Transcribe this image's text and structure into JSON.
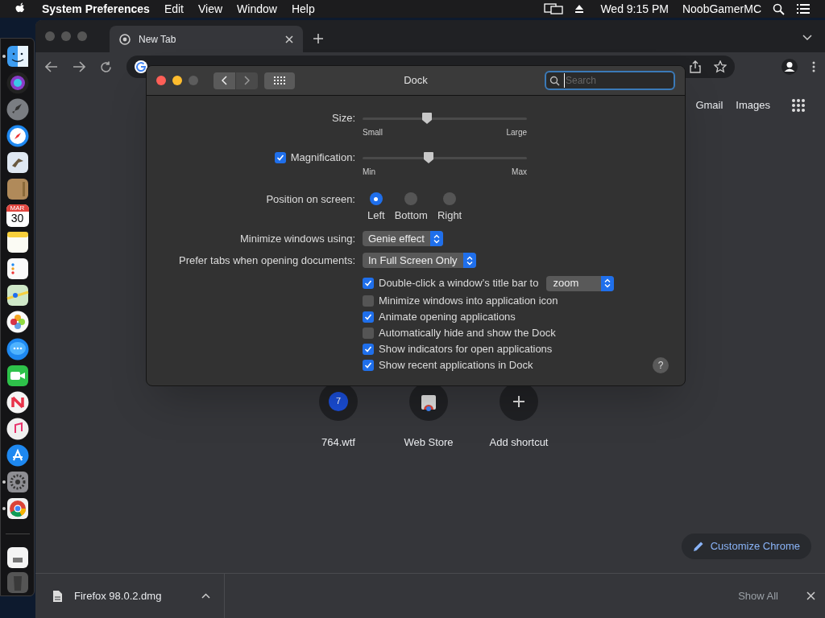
{
  "menu_bar": {
    "app": "System Preferences",
    "menus": [
      "Edit",
      "View",
      "Window",
      "Help"
    ],
    "clock": "Wed 9:15 PM",
    "user": "NoobGamerMC"
  },
  "dock": {
    "items": [
      {
        "kind": "finder",
        "running": true
      },
      {
        "kind": "siri",
        "running": false
      },
      {
        "kind": "launchpad",
        "running": false
      },
      {
        "kind": "safari",
        "running": false
      },
      {
        "kind": "mail",
        "running": false
      },
      {
        "kind": "contacts",
        "running": false
      },
      {
        "kind": "calendar",
        "running": false,
        "month": "MAR",
        "day": "30"
      },
      {
        "kind": "notes",
        "running": false
      },
      {
        "kind": "reminders",
        "running": false
      },
      {
        "kind": "maps",
        "running": false
      },
      {
        "kind": "photos",
        "running": false
      },
      {
        "kind": "messages",
        "running": false
      },
      {
        "kind": "facetime",
        "running": false
      },
      {
        "kind": "news",
        "running": false
      },
      {
        "kind": "music",
        "running": false
      },
      {
        "kind": "appstore",
        "running": false
      },
      {
        "kind": "prefs",
        "running": true
      },
      {
        "kind": "chrome",
        "running": true
      }
    ],
    "extras": [
      {
        "kind": "document"
      },
      {
        "kind": "trash"
      }
    ]
  },
  "browser": {
    "tabs": [
      {
        "title": "New Tab",
        "selected": true
      }
    ],
    "links": [
      "Gmail",
      "Images"
    ],
    "shortcuts": [
      {
        "kind": "letter",
        "letter": "7",
        "label": "764.wtf"
      },
      {
        "kind": "store",
        "label": "Web Store"
      },
      {
        "kind": "add",
        "label": "Add shortcut"
      }
    ],
    "customize": "Customize Chrome",
    "download": {
      "file": "Firefox 98.0.2.dmg",
      "show_all": "Show All"
    }
  },
  "prefs": {
    "title": "Dock",
    "search": {
      "placeholder": "Search"
    },
    "sliders": [
      {
        "kind": "plain",
        "label": "Size:",
        "level": 0.39,
        "min": "Small",
        "max": "Large"
      },
      {
        "kind": "checkable",
        "label": "Magnification:",
        "checked": true,
        "level": 0.4,
        "min": "Min",
        "max": "Max"
      }
    ],
    "position": {
      "label": "Position on screen:",
      "options": [
        {
          "label": "Left",
          "selected": true
        },
        {
          "label": "Bottom",
          "selected": false
        },
        {
          "label": "Right",
          "selected": false
        }
      ]
    },
    "popups": [
      {
        "label": "Minimize windows using:",
        "value": "Genie effect"
      },
      {
        "label": "Prefer tabs when opening documents:",
        "value": "In Full Screen Only"
      }
    ],
    "checks": [
      {
        "label": "Double-click a window’s title bar to",
        "checked": true,
        "popup": "zoom"
      },
      {
        "label": "Minimize windows into application icon",
        "checked": false
      },
      {
        "label": "Animate opening applications",
        "checked": true
      },
      {
        "label": "Automatically hide and show the Dock",
        "checked": false
      },
      {
        "label": "Show indicators for open applications",
        "checked": true
      },
      {
        "label": "Show recent applications in Dock",
        "checked": true
      }
    ],
    "help": "?"
  }
}
